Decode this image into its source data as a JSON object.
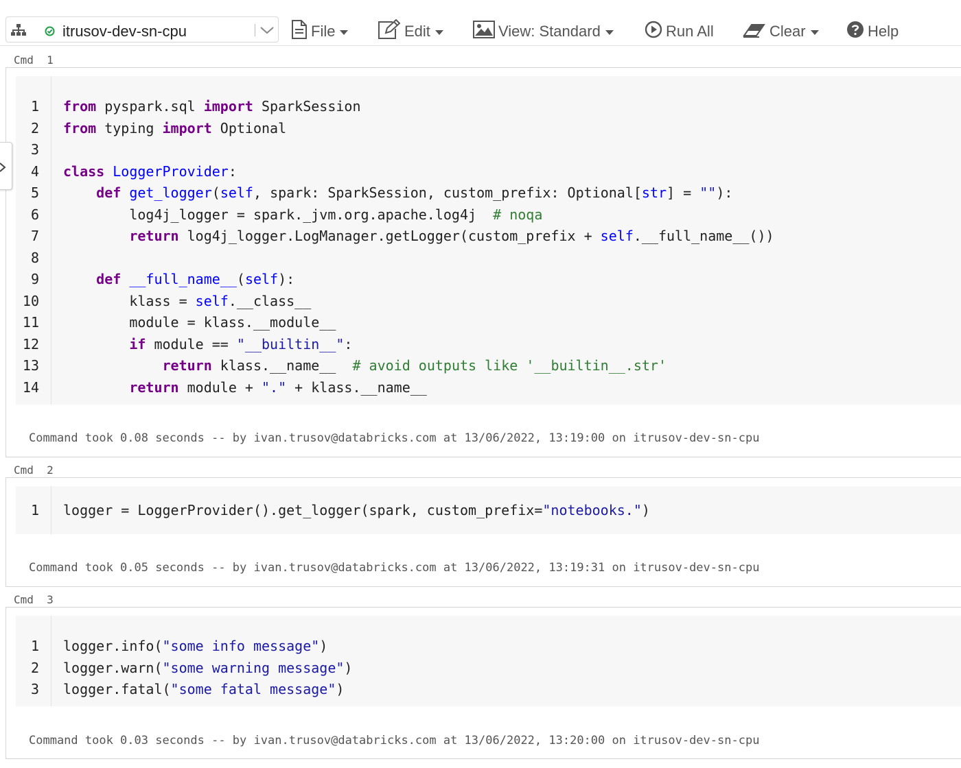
{
  "toolbar": {
    "cluster_name": "itrusov-dev-sn-cpu",
    "status_color": "#24a148",
    "items": [
      {
        "label": "File",
        "icon": "document-icon"
      },
      {
        "label": "Edit",
        "icon": "edit-icon"
      },
      {
        "label": "View: Standard",
        "icon": "image-icon"
      },
      {
        "label": "Run All",
        "icon": "play-circle-icon"
      },
      {
        "label": "Clear",
        "icon": "eraser-icon"
      },
      {
        "label": "Help",
        "icon": "help-circle-icon"
      }
    ]
  },
  "cells": [
    {
      "label": "Cmd  1",
      "lines": [
        "from pyspark.sql import SparkSession",
        "from typing import Optional",
        "",
        "class LoggerProvider:",
        "    def get_logger(self, spark: SparkSession, custom_prefix: Optional[str] = \"\"):",
        "        log4j_logger = spark._jvm.org.apache.log4j  # noqa",
        "        return log4j_logger.LogManager.getLogger(custom_prefix + self.__full_name__())",
        "",
        "    def __full_name__(self):",
        "        klass = self.__class__",
        "        module = klass.__module__",
        "        if module == \"__builtin__\":",
        "            return klass.__name__  # avoid outputs like '__builtin__.str'",
        "        return module + \".\" + klass.__name__"
      ],
      "result": "Command took 0.08 seconds -- by ivan.trusov@databricks.com at 13/06/2022, 13:19:00 on itrusov-dev-sn-cpu"
    },
    {
      "label": "Cmd  2",
      "lines": [
        "logger = LoggerProvider().get_logger(spark, custom_prefix=\"notebooks.\")"
      ],
      "result": "Command took 0.05 seconds -- by ivan.trusov@databricks.com at 13/06/2022, 13:19:31 on itrusov-dev-sn-cpu"
    },
    {
      "label": "Cmd  3",
      "lines": [
        "logger.info(\"some info message\")",
        "logger.warn(\"some warning message\")",
        "logger.fatal(\"some fatal message\")"
      ],
      "result": "Command took 0.03 seconds -- by ivan.trusov@databricks.com at 13/06/2022, 13:20:00 on itrusov-dev-sn-cpu"
    }
  ],
  "syntax_colors": {
    "keyword": "#770088",
    "def_name": "#0000ff",
    "string": "#1a1aa6",
    "comment": "#2e7d32"
  }
}
